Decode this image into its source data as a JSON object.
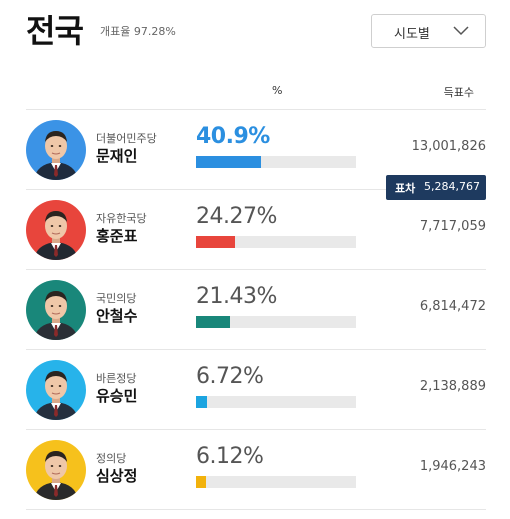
{
  "header": {
    "title": "전국",
    "count_progress": "개표율 97.28%",
    "region_select": "시도별"
  },
  "columns": {
    "percent": "%",
    "votes": "득표수"
  },
  "margin": {
    "label": "표차",
    "value": "5,284,767"
  },
  "candidates": [
    {
      "party": "더불어민주당",
      "name": "문재인",
      "percent_text": "40.9%",
      "percent": 40.9,
      "votes": "13,001,826",
      "color": "#2b8fe0",
      "avatar_bg": "#3b93e6",
      "suit": "#1f2b3d"
    },
    {
      "party": "자유한국당",
      "name": "홍준표",
      "percent_text": "24.27%",
      "percent": 24.27,
      "votes": "7,717,059",
      "color": "#e8453c",
      "avatar_bg": "#e8453c",
      "suit": "#222831"
    },
    {
      "party": "국민의당",
      "name": "안철수",
      "percent_text": "21.43%",
      "percent": 21.43,
      "votes": "6,814,472",
      "color": "#19877a",
      "avatar_bg": "#19877a",
      "suit": "#2a2f36"
    },
    {
      "party": "바른정당",
      "name": "유승민",
      "percent_text": "6.72%",
      "percent": 6.72,
      "votes": "2,138,889",
      "color": "#1ca4e0",
      "avatar_bg": "#27b3ea",
      "suit": "#25303f"
    },
    {
      "party": "정의당",
      "name": "심상정",
      "percent_text": "6.12%",
      "percent": 6.12,
      "votes": "1,946,243",
      "color": "#f2b20c",
      "avatar_bg": "#f6c11c",
      "suit": "#2a2a2a"
    }
  ]
}
